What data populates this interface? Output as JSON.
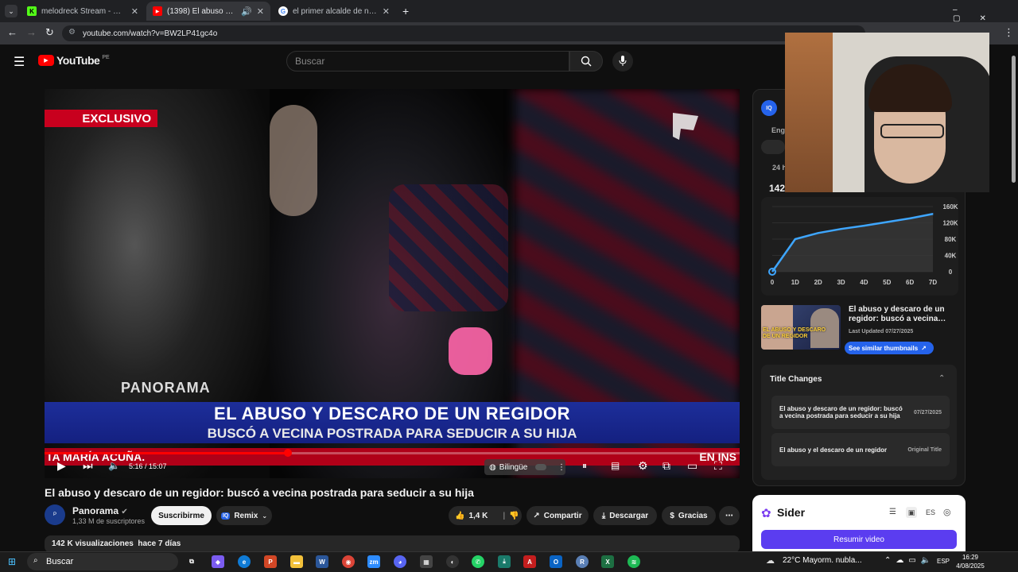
{
  "browser": {
    "tabs": [
      {
        "label": "melodreck Stream - Watch Live"
      },
      {
        "label": "(1398) El abuso y descaro d"
      },
      {
        "label": "el primer alcalde de new york"
      }
    ],
    "url": "youtube.com/watch?v=BW2LP41gc4o"
  },
  "youtube": {
    "logo": "YouTube",
    "region": "PE",
    "search_placeholder": "Buscar"
  },
  "video": {
    "exclusive_tag": "EXCLUSIVO",
    "channel_watermark": "PANORAMA",
    "headline": "EL ABUSO Y DESCARO DE UN REGIDOR",
    "subheadline": "BUSCÓ A VECINA POSTRADA PARA SEDUCIR A SU HIJA",
    "ticker_left": "TA MARÍA ACUÑA.",
    "ticker_right": "EN INS",
    "time": "5:16 / 15:07",
    "progress": 0.35,
    "caption_lang": "Bilingüe",
    "title": "El abuso y descaro de un regidor: buscó a vecina postrada para seducir a su hija"
  },
  "channel": {
    "name": "Panorama",
    "subscribers": "1,33 M de suscriptores",
    "subscribe_label": "Suscribirme",
    "remix_label": "Remix"
  },
  "actions": {
    "likes": "1,4 K",
    "share": "Compartir",
    "download": "Descargar",
    "thanks": "Gracias"
  },
  "description": {
    "views": "142 K visualizaciones",
    "age": "hace 7 días"
  },
  "vidiq": {
    "engagement_label": "Enga",
    "period": "24 h",
    "views_value": "142",
    "chart_data": {
      "type": "area",
      "x": [
        "0",
        "1D",
        "2D",
        "3D",
        "4D",
        "5D",
        "6D",
        "7D"
      ],
      "values": [
        0,
        80000,
        95000,
        105000,
        113000,
        122000,
        131000,
        142000
      ],
      "y_ticks": [
        "160K",
        "120K",
        "80K",
        "40K",
        "0"
      ],
      "ylim": [
        0,
        160000
      ],
      "color": "#3ea6ff"
    },
    "thumb_title": "El abuso y descaro de un regidor: buscó a vecina…",
    "thumb_updated": "Last Updated 07/27/2025",
    "thumb_overlay_l1": "EL ABUSO Y DESCARO",
    "thumb_overlay_l2": "DE UN REGIDOR",
    "similar_btn": "See similar thumbnails",
    "title_changes_heading": "Title Changes",
    "title_changes": [
      {
        "title": "El abuso y descaro de un regidor: buscó a vecina postrada para seducir a su hija",
        "date": "07/27/2025"
      },
      {
        "title": "El abuso y el descaro de un regidor",
        "date": "Original Title"
      }
    ]
  },
  "sider": {
    "name": "Sider",
    "lang": "ES",
    "summarize_btn": "Resumir video"
  },
  "taskbar": {
    "search": "Buscar",
    "weather": "22°C  Mayorm. nubla...",
    "lang": "ESP",
    "time": "16:29",
    "date": "4/08/2025"
  }
}
